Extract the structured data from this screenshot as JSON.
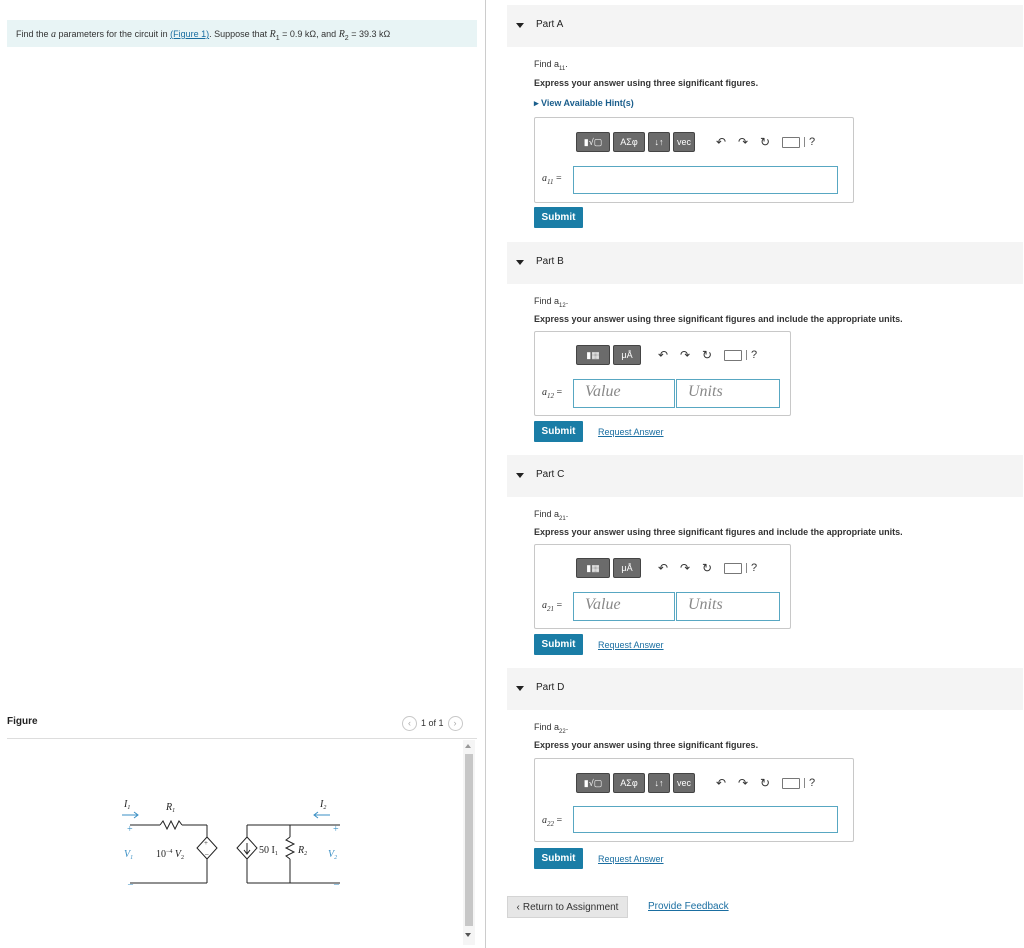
{
  "problem": {
    "prefix": "Find the ",
    "a_sym": "a",
    "middle": " parameters for the circuit in ",
    "figure_link": "(Figure 1)",
    "suffix": ". Suppose that ",
    "r1_sym": "R",
    "r1_sub": "1",
    "r1_eq": " = 0.9 kΩ",
    "and": ", and ",
    "r2_sym": "R",
    "r2_sub": "2",
    "r2_eq": " = 39.3 kΩ"
  },
  "figure": {
    "title": "Figure",
    "pager_text": "1 of 1",
    "circuit": {
      "i1": "I",
      "i1_sub": "1",
      "r1": "R",
      "r1_sub": "1",
      "i2": "I",
      "i2_sub": "2",
      "v1": "V",
      "v1_sub": "1",
      "dep_v": "10",
      "dep_v_exp": "−4",
      "dep_v_var": " V",
      "dep_v_sub": "2",
      "dep_i": "50 I",
      "dep_i_sub": "1",
      "r2": "R",
      "r2_sub": "2",
      "v2": "V",
      "v2_sub": "2",
      "plus": "+",
      "minus": "–"
    }
  },
  "parts": {
    "a": {
      "title": "Part A",
      "find": "Find a",
      "find_sub": "11",
      "instruction": "Express your answer using three significant figures.",
      "hint": "View Available Hint(s)",
      "label": "a",
      "label_sub": "11",
      "toolbar": [
        "ΑΣφ",
        "↓↑",
        "vec"
      ],
      "submit": "Submit"
    },
    "b": {
      "title": "Part B",
      "find": "Find a",
      "find_sub": "12",
      "instruction": "Express your answer using three significant figures and include the appropriate units.",
      "label": "a",
      "label_sub": "12",
      "mu_btn": "μÅ",
      "value_placeholder": "Value",
      "units_placeholder": "Units",
      "submit": "Submit",
      "request": "Request Answer"
    },
    "c": {
      "title": "Part C",
      "find": "Find a",
      "find_sub": "21",
      "instruction": "Express your answer using three significant figures and include the appropriate units.",
      "label": "a",
      "label_sub": "21",
      "mu_btn": "μÅ",
      "value_placeholder": "Value",
      "units_placeholder": "Units",
      "submit": "Submit",
      "request": "Request Answer"
    },
    "d": {
      "title": "Part D",
      "find": "Find a",
      "find_sub": "22",
      "instruction": "Express your answer using three significant figures.",
      "label": "a",
      "label_sub": "22",
      "toolbar": [
        "ΑΣφ",
        "↓↑",
        "vec"
      ],
      "submit": "Submit",
      "request": "Request Answer"
    }
  },
  "toolbar_common": {
    "eq_sign": " =",
    "question": "?"
  },
  "footer": {
    "return": "Return to Assignment",
    "feedback": "Provide Feedback"
  },
  "colors": {
    "accent": "#1a7da6",
    "link": "#1a6ea1",
    "input_border": "#58a7c2",
    "problem_bg": "#e8f4f5"
  }
}
